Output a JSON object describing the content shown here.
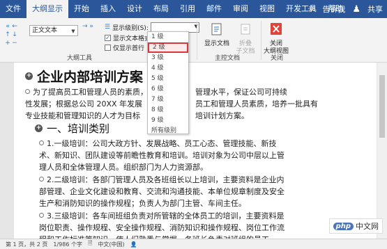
{
  "tabs": [
    "文件",
    "大纲显示",
    "开始",
    "插入",
    "设计",
    "布局",
    "引用",
    "邮件",
    "审阅",
    "视图",
    "开发工具",
    "帮助"
  ],
  "active_tab": "大纲显示",
  "tell_me": "告诉我",
  "share": "共享",
  "ribbon": {
    "level_value": "正文文本",
    "show_level_label": "显示级别(S):",
    "show_text_format": "显示文本格式",
    "show_first_line": "仅显示首行",
    "group_outline_tools": "大纲工具",
    "show_document": "显示文档",
    "collapse_subdocs": "折叠\n子文档",
    "group_master": "主控文档",
    "close_outline": "关闭\n大纲视图",
    "group_close": "关闭"
  },
  "dropdown_levels": [
    "1 级",
    "2 级",
    "3 级",
    "4 级",
    "5 级",
    "6 级",
    "7 级",
    "8 级",
    "9 级",
    "所有级别"
  ],
  "document": {
    "title": "企业内部培训方案",
    "intro_line1": "为了提高员工和管理人员的素质，",
    "intro_line1b": "管理水平，保证公司可持续",
    "intro_line2": "性发展；根据总公司 20XX 年发展",
    "intro_line2b": "员工和管理人员素质，培养一批具有",
    "intro_line3": "专业技能和管理知识的人才为目标",
    "intro_line3b": "培训计划方案。",
    "section": "一、培训类别",
    "item1": "1.一级培训：公司大政方针、发展战略、员工心态、管理技能、新技术、新知识、团队建设等前瞻性教育和培训。培训对象为公司中层以上管理人员和全体管理人员。组织部门为人力资源部。",
    "item2": "2.二级培训：各部门管理人员及各班组长以上培训，主要资料是企业内部管理、企业文化建设和教育、交流和沟通技能、本单位规章制度及安全生产和消防知识的操作规程；负责人为部门主管、车间主任。",
    "item3": "3.三级培训：各车间班组负责对所管辖的全体员工的培训，主要资料是岗位职责、操作规程、安全操作规程、消防知识和操作规程、岗位工作流程和工作标准等知识，使人们熟悉与掌握，各班长负责对班组的员工"
  },
  "status": {
    "page": "第 1 页，共 2 页",
    "words": "1/986 个字",
    "lang": "中文(中国)"
  },
  "watermark": {
    "brand": "php",
    "text": "中文网"
  }
}
